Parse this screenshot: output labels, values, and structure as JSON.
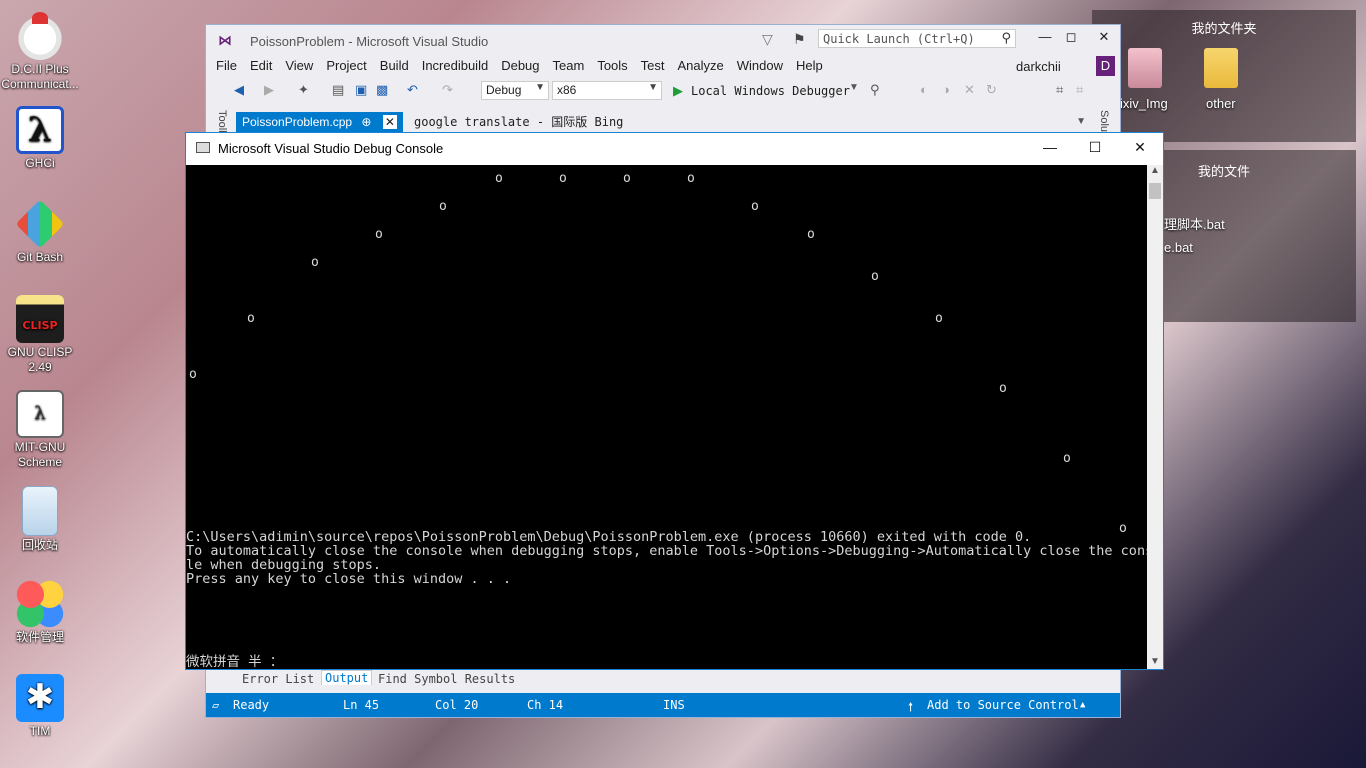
{
  "desktop": {
    "icons": [
      {
        "label": "D.C.II Plus Communicat..."
      },
      {
        "label": "GHCi"
      },
      {
        "label": "Git Bash"
      },
      {
        "label": "GNU CLISP 2.49"
      },
      {
        "label": "MIT-GNU Scheme"
      },
      {
        "label": "回收站"
      },
      {
        "label": "软件管理"
      },
      {
        "label": "TIM"
      }
    ],
    "panel1_title": "我的文件夹",
    "panel1_items": [
      {
        "label": "ixiv_Img"
      },
      {
        "label": "other"
      }
    ],
    "panel2_title": "我的文件",
    "panel2_items": [
      {
        "label": "理脚本.bat"
      },
      {
        "label": "e.bat"
      }
    ]
  },
  "vs": {
    "title": "PoissonProblem - Microsoft Visual Studio",
    "quick_launch_placeholder": "Quick Launch (Ctrl+Q)",
    "menu": [
      "File",
      "Edit",
      "View",
      "Project",
      "Build",
      "Incredibuild",
      "Debug",
      "Team",
      "Tools",
      "Test",
      "Analyze",
      "Window",
      "Help"
    ],
    "account": "darkchii",
    "account_initial": "D",
    "config": "Debug",
    "platform": "x86",
    "run_label": "Local Windows Debugger",
    "side_left": "Toolbox",
    "side_right": "Solution Explorer",
    "tabs": [
      {
        "label": "PoissonProblem.cpp",
        "pin": "⊕",
        "close": "✕"
      },
      {
        "label": "google translate - 国际版 Bing"
      }
    ],
    "bottom_tabs": [
      "Error List",
      "Output",
      "Find Symbol Results"
    ],
    "status": {
      "ready": "Ready",
      "ln": "Ln 45",
      "col": "Col 20",
      "ch": "Ch 14",
      "ins": "INS",
      "source_control": "Add to Source Control"
    }
  },
  "console": {
    "title": "Microsoft Visual Studio Debug Console",
    "point_glyph": "o",
    "lines": [
      "C:\\Users\\adimin\\source\\repos\\PoissonProblem\\Debug\\PoissonProblem.exe (process 10660) exited with code 0.",
      "To automatically close the console when debugging stops, enable Tools->Options->Debugging->Automatically close the conso",
      "le when debugging stops.",
      "Press any key to close this window . . ."
    ],
    "ime": "微软拼音 半 ："
  }
}
